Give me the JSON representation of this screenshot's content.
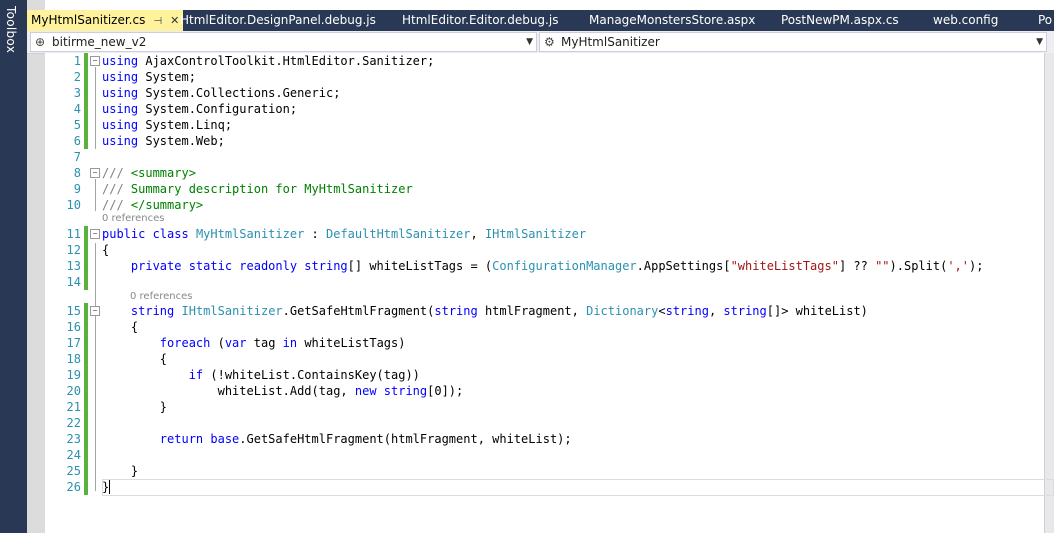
{
  "toolbox": {
    "label": "Toolbox"
  },
  "tabs": [
    {
      "label": "MyHtmlSanitizer.cs",
      "active": true
    },
    {
      "label": "HtmlEditor.DesignPanel.debug.js"
    },
    {
      "label": "HtmlEditor.Editor.debug.js"
    },
    {
      "label": "ManageMonstersStore.aspx"
    },
    {
      "label": "PostNewPM.aspx.cs"
    },
    {
      "label": "web.config"
    },
    {
      "label": "Po"
    }
  ],
  "tab_icons": {
    "pin": "pin-icon",
    "close": "close-icon"
  },
  "navbar": {
    "project": "bitirme_new_v2",
    "class": "MyHtmlSanitizer"
  },
  "code": {
    "line_numbers": [
      "1",
      "2",
      "3",
      "4",
      "5",
      "6",
      "7",
      "8",
      "9",
      "10",
      "11",
      "12",
      "13",
      "14",
      "15",
      "16",
      "17",
      "18",
      "19",
      "20",
      "21",
      "22",
      "23",
      "24",
      "25",
      "26"
    ],
    "lens_1": "0 references",
    "lens_2": "0 references",
    "using_kw": "using",
    "l1": "AjaxControlToolkit.HtmlEditor.Sanitizer;",
    "l2": "System;",
    "l3": "System.Collections.Generic;",
    "l4": "System.Configuration;",
    "l5": "System.Linq;",
    "l6": "System.Web;",
    "l8_a": "///",
    "l8_b": " <summary>",
    "l9_a": "///",
    "l9_b": " Summary description for MyHtmlSanitizer",
    "l10_a": "///",
    "l10_b": " </summary>",
    "l11_kw": "public class",
    "l11_name": "MyHtmlSanitizer",
    "l11_sep": " : ",
    "l11_base": "DefaultHtmlSanitizer",
    "l11_comma": ", ",
    "l11_iface": "IHtmlSanitizer",
    "l12": "{",
    "l13_kw": "private static readonly string",
    "l13_a": "[] whiteListTags = (",
    "l13_type": "ConfigurationManager",
    "l13_b": ".AppSettings[",
    "l13_str1": "\"whiteListTags\"",
    "l13_c": "] ?? ",
    "l13_str2": "\"\"",
    "l13_d": ").Split(",
    "l13_str3": "','",
    "l13_e": ");",
    "l15_kw": "string",
    "l15_iface": "IHtmlSanitizer",
    "l15_a": ".GetSafeHtmlFragment(",
    "l15_kw2": "string",
    "l15_b": " htmlFragment, ",
    "l15_type": "Dictionary",
    "l15_c": "<",
    "l15_kw3": "string",
    "l15_d": ", ",
    "l15_kw4": "string",
    "l15_e": "[]> whiteList)",
    "l16": "{",
    "l17_kw": "foreach",
    "l17_a": " (",
    "l17_kw2": "var",
    "l17_b": " tag ",
    "l17_kw3": "in",
    "l17_c": " whiteListTags)",
    "l18": "{",
    "l19_kw": "if",
    "l19_a": " (!whiteList.ContainsKey(tag))",
    "l20_a": "whiteList.Add(tag, ",
    "l20_kw": "new string",
    "l20_b": "[0]);",
    "l21": "}",
    "l23_kw": "return base",
    "l23_a": ".GetSafeHtmlFragment(htmlFragment, whiteList);",
    "l25": "}",
    "l26": "}"
  },
  "colors": {
    "keyword": "#0000ff",
    "type": "#2b91af",
    "string": "#a31515",
    "comment": "#008000",
    "change_marker": "#57b33e",
    "active_tab": "#fff29d",
    "chrome": "#293955"
  }
}
